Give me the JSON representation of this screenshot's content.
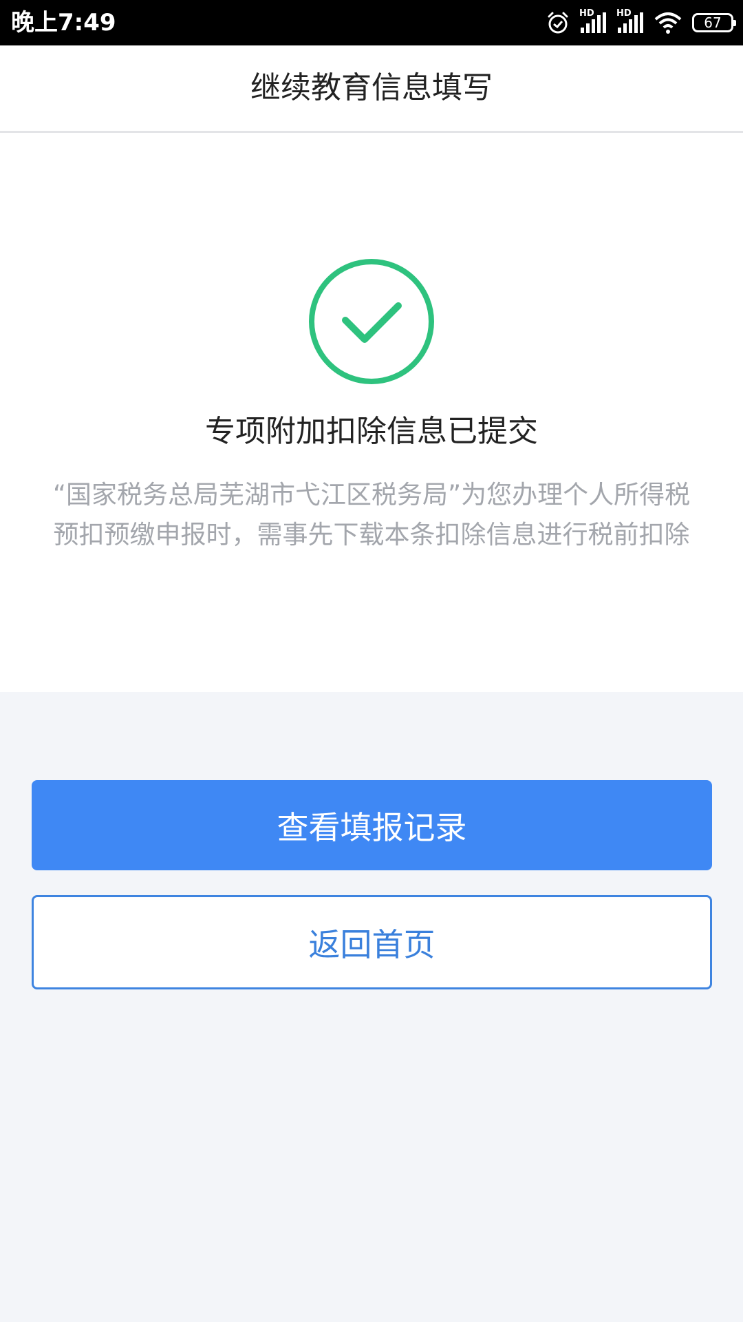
{
  "status_bar": {
    "time": "晚上7:49",
    "hd_label_1": "HD",
    "hd_label_2": "HD",
    "battery": "67",
    "icons": [
      "alarm-icon",
      "signal-icon",
      "signal-icon",
      "wifi-icon",
      "battery-icon"
    ]
  },
  "header": {
    "title": "继续教育信息填写"
  },
  "result": {
    "icon": "check-circle-icon",
    "icon_color": "#2ec27e",
    "title": "专项附加扣除信息已提交",
    "description": "“国家税务总局芜湖市弋江区税务局”为您办理个人所得税预扣预缴申报时，需事先下载本条扣除信息进行税前扣除"
  },
  "actions": {
    "primary_label": "查看填报记录",
    "secondary_label": "返回首页",
    "primary_color": "#3f88f4"
  }
}
